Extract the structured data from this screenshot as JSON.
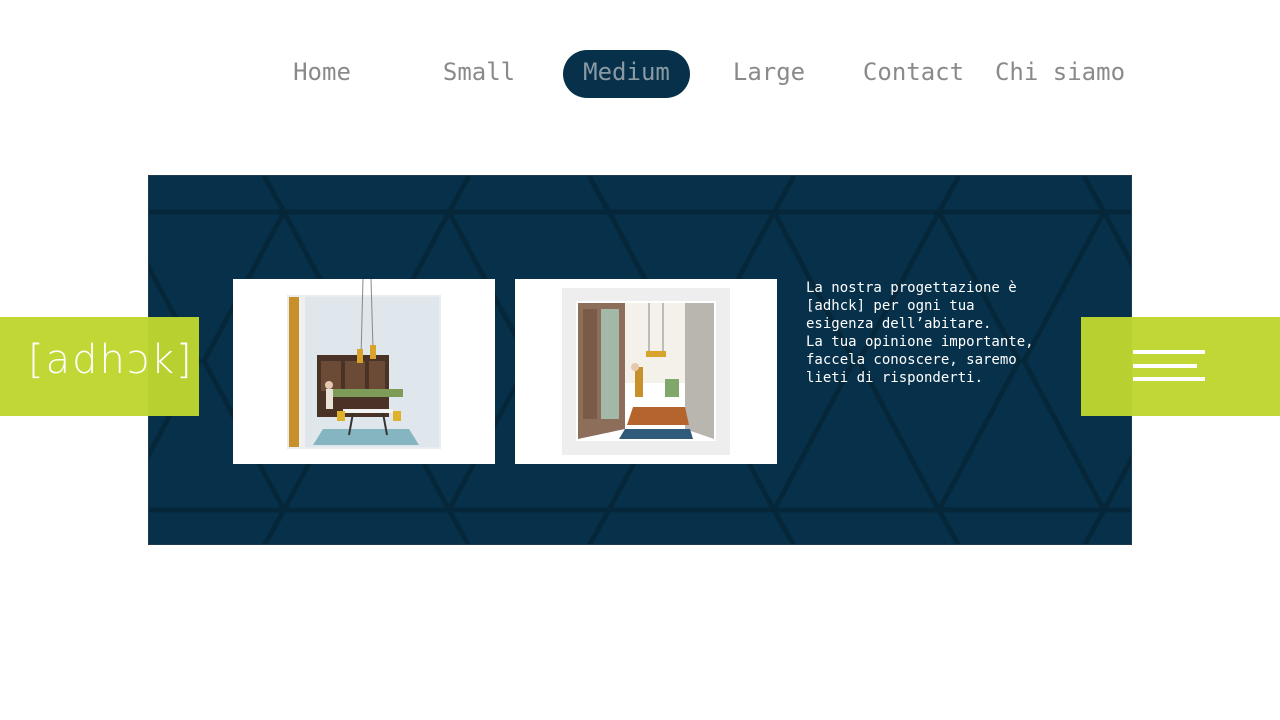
{
  "nav": {
    "items": [
      {
        "label": "Home"
      },
      {
        "label": "Small"
      },
      {
        "label": "Medium",
        "active": true
      },
      {
        "label": "Large"
      },
      {
        "label": "Contact"
      },
      {
        "label": "Chi siamo"
      }
    ]
  },
  "logo": {
    "text": "[adhɔk]"
  },
  "banner": {
    "description": "La nostra progettazione è\n[adhck] per ogni tua\nesigenza dell’abitare.\nLa tua opinione importante,\nfaccela conoscere, saremo\nlieti di risponderti."
  },
  "menu": {
    "icon": "hamburger-menu-icon"
  },
  "colors": {
    "accent": "#bed630",
    "navy": "#07314a",
    "nav_text": "#8a8a8a"
  }
}
